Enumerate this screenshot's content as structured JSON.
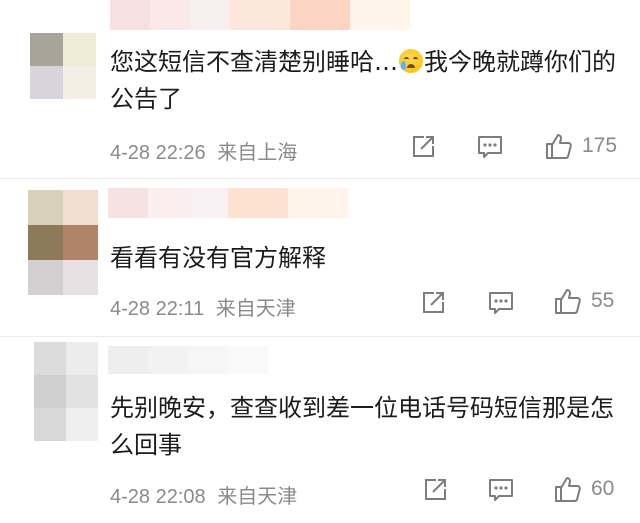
{
  "comments": [
    {
      "text": "您这短信不查清楚别睡哈…",
      "text_after_emoji": "我今晚就蹲你们的公告了",
      "emoji": "crying-face-emoji",
      "date": "4-28 22:26",
      "location": "来自上海",
      "likes": "175"
    },
    {
      "text": "看看有没有官方解释",
      "date": "4-28 22:11",
      "location": "来自天津",
      "likes": "55"
    },
    {
      "text": "先别晚安，查查收到差一位电话号码短信那是怎么回事",
      "date": "4-28 22:08",
      "location": "来自天津",
      "likes": "60"
    }
  ],
  "icons": {
    "share": "share-icon",
    "reply": "comment-icon",
    "like": "thumbs-up-icon"
  },
  "colors": {
    "meta_text": "#8a8a8a",
    "body_text": "#1c1c1c",
    "icon": "#7d7d7d",
    "divider": "#ececec"
  }
}
